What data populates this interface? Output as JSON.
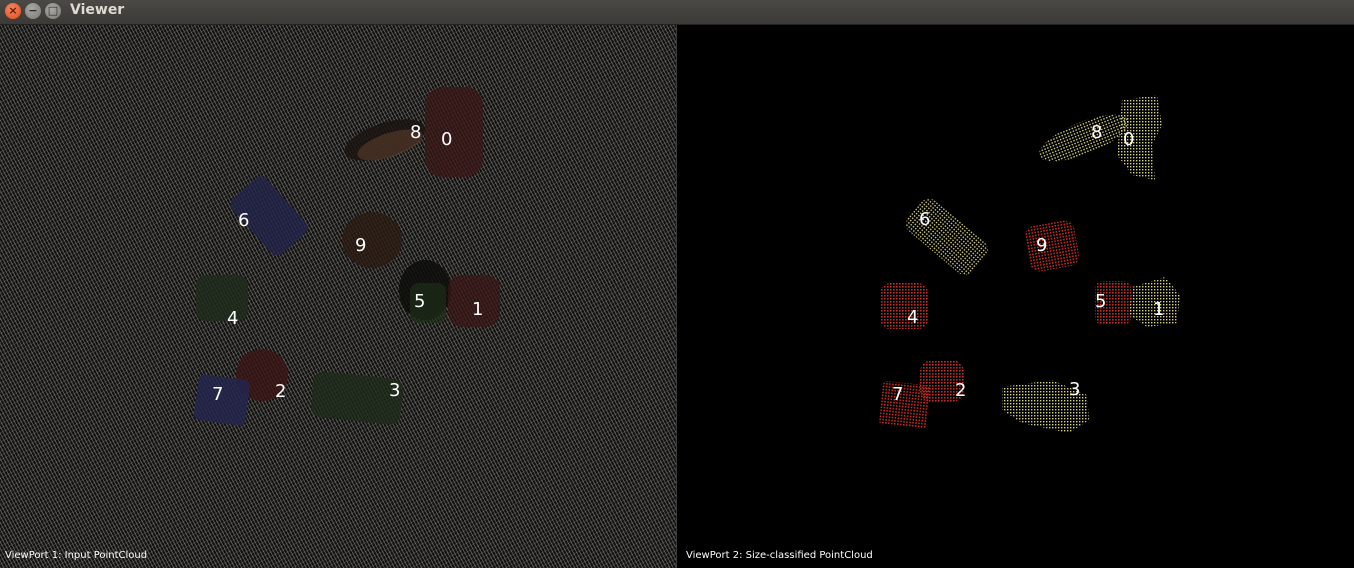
{
  "window": {
    "title": "Viewer",
    "close_icon": "×",
    "minimize_icon": "−",
    "maximize_icon": "□"
  },
  "viewport1": {
    "caption": "ViewPort 1: Input PointCloud",
    "labels": [
      "8",
      "0",
      "6",
      "9",
      "5",
      "1",
      "4",
      "7",
      "2",
      "3"
    ]
  },
  "viewport2": {
    "caption": "ViewPort 2: Size-classified PointCloud",
    "labels": [
      "8",
      "0",
      "6",
      "9",
      "5",
      "1",
      "4",
      "7",
      "2",
      "3"
    ],
    "colors": {
      "large": "#d8d27a",
      "small": "#c42b22"
    }
  }
}
